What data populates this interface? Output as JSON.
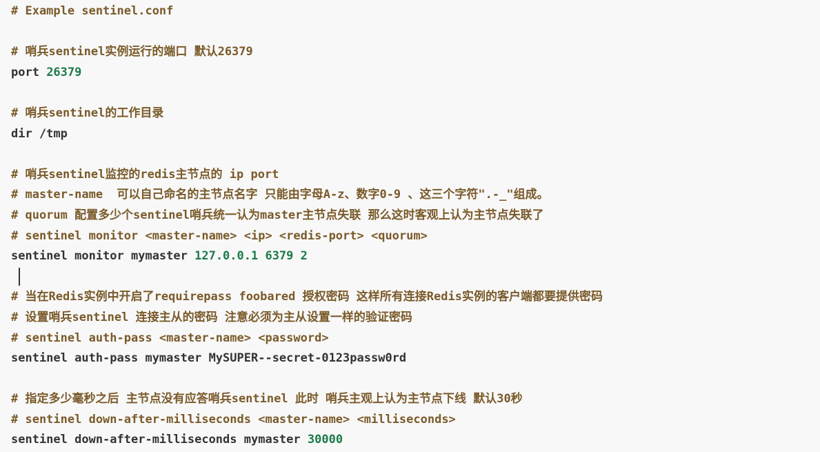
{
  "editor": {
    "lines": [
      {
        "kind": "comment",
        "text": "# Example sentinel.conf"
      },
      {
        "kind": "blank",
        "text": ""
      },
      {
        "kind": "comment",
        "text": "# 哨兵sentinel实例运行的端口 默认26379"
      },
      {
        "kind": "directive",
        "key": "port ",
        "value": "26379"
      },
      {
        "kind": "blank",
        "text": ""
      },
      {
        "kind": "comment",
        "text": "# 哨兵sentinel的工作目录"
      },
      {
        "kind": "directive",
        "key": "dir /tmp",
        "value": ""
      },
      {
        "kind": "blank",
        "text": ""
      },
      {
        "kind": "comment",
        "text": "# 哨兵sentinel监控的redis主节点的 ip port"
      },
      {
        "kind": "comment",
        "text": "# master-name  可以自己命名的主节点名字 只能由字母A-z、数字0-9 、这三个字符\".-_\"组成。"
      },
      {
        "kind": "comment",
        "text": "# quorum 配置多少个sentinel哨兵统一认为master主节点失联 那么这时客观上认为主节点失联了"
      },
      {
        "kind": "comment",
        "text": "# sentinel monitor <master-name> <ip> <redis-port> <quorum>"
      },
      {
        "kind": "directive",
        "key": "sentinel monitor mymaster ",
        "value": "127.0.0.1 6379 2"
      },
      {
        "kind": "cursor",
        "text": ""
      },
      {
        "kind": "comment",
        "text": "# 当在Redis实例中开启了requirepass foobared 授权密码 这样所有连接Redis实例的客户端都要提供密码"
      },
      {
        "kind": "comment",
        "text": "# 设置哨兵sentinel 连接主从的密码 注意必须为主从设置一样的验证密码"
      },
      {
        "kind": "comment",
        "text": "# sentinel auth-pass <master-name> <password>"
      },
      {
        "kind": "directive",
        "key": "sentinel auth-pass mymaster MySUPER--secret-0123passw0rd",
        "value": ""
      },
      {
        "kind": "blank",
        "text": ""
      },
      {
        "kind": "comment",
        "text": "# 指定多少毫秒之后 主节点没有应答哨兵sentinel 此时 哨兵主观上认为主节点下线 默认30秒"
      },
      {
        "kind": "comment",
        "text": "# sentinel down-after-milliseconds <master-name> <milliseconds>"
      },
      {
        "kind": "directive",
        "key": "sentinel down-after-milliseconds mymaster ",
        "value": "30000"
      }
    ]
  }
}
